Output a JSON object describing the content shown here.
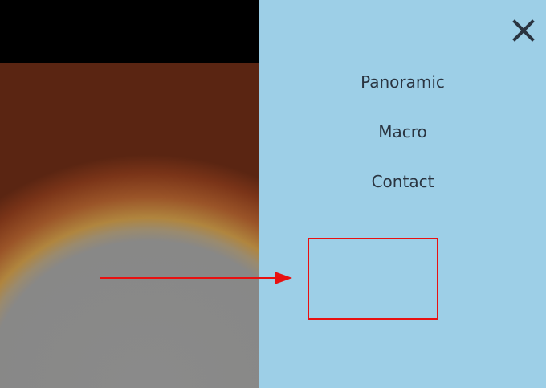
{
  "close_icon": "close-x-icon",
  "menu": {
    "items": [
      {
        "label": "Panoramic"
      },
      {
        "label": "Macro"
      },
      {
        "label": "Contact"
      }
    ]
  },
  "colors": {
    "panel_background": "#9dcfe7",
    "menu_text": "#2a3440",
    "annotation": "#e81010"
  }
}
